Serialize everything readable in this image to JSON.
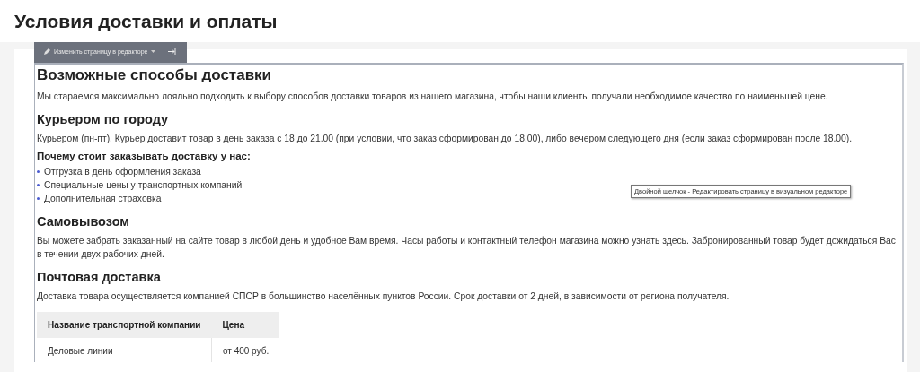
{
  "page_title": "Условия доставки и оплаты",
  "editor_toolbar": {
    "button": "Изменить страницу в редакторе"
  },
  "sections": [
    {
      "kind": "h1",
      "text": "Возможные способы доставки"
    },
    {
      "kind": "p",
      "text": "Мы стараемся максимально лояльно подходить к выбору способов доставки товаров из нашего магазина, чтобы наши клиенты получали необходимое качество по наименьшей цене."
    },
    {
      "kind": "h2",
      "text": "Курьером по городу"
    },
    {
      "kind": "p",
      "text": "Курьером (пн-пт). Курьер доставит товар в день заказа с 18 до 21.00 (при условии, что заказ сформирован до 18.00), либо вечером следующего дня (если заказ сформирован после 18.00)."
    },
    {
      "kind": "h3",
      "text": "Почему стоит заказывать доставку у нас:"
    },
    {
      "kind": "list",
      "items": [
        "Отгрузка в день оформления заказа",
        "Специальные цены у транспортных компаний",
        "Дополнительная страховка"
      ]
    },
    {
      "kind": "h2",
      "text": "Самовывозом"
    },
    {
      "kind": "p",
      "text": "Вы можете забрать заказанный на сайте товар в любой день и удобное Вам время. Часы работы и контактный телефон магазина можно узнать здесь. Забронированный товар будет дожидаться Вас в течении двух рабочих дней."
    },
    {
      "kind": "h2",
      "text": "Почтовая доставка"
    },
    {
      "kind": "p",
      "text": "Доставка товара осуществляется компанией СПСР в большинство населённых пунктов России. Срок доставки от 2 дней, в зависимости от региона получателя."
    },
    {
      "kind": "table",
      "columns": [
        "Название транспортной компании",
        "Цена"
      ],
      "rows": [
        [
          "Деловые линии",
          "от 400 руб."
        ]
      ]
    }
  ],
  "tooltip": "Двойной щелчок - Редактировать страницу в визуальном редакторе"
}
